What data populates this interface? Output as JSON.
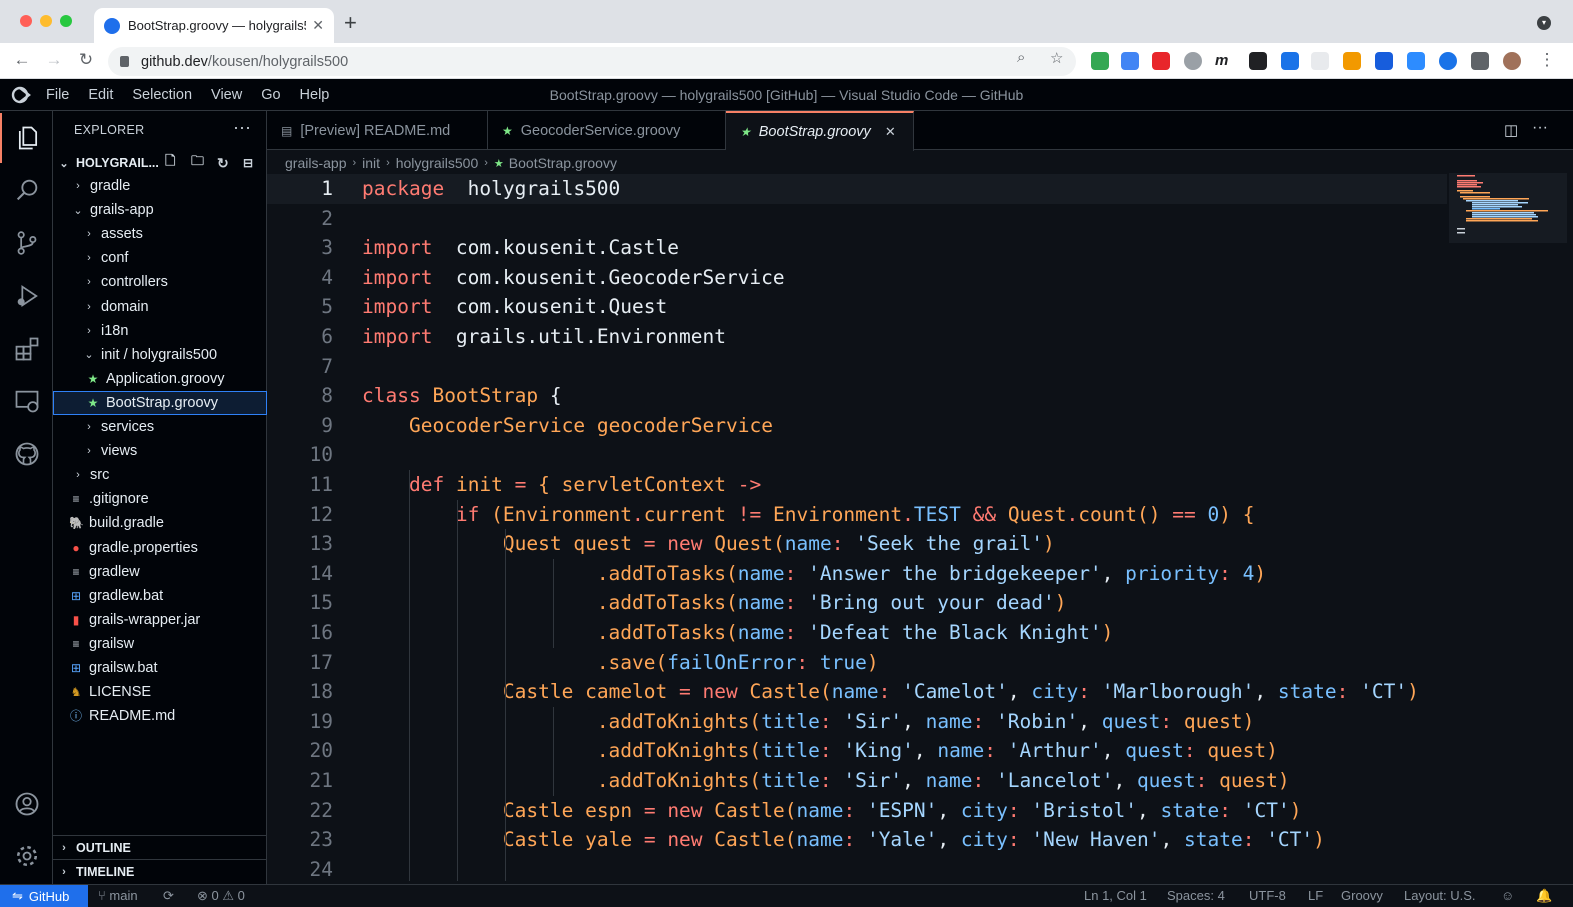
{
  "browser": {
    "tab_title": "BootStrap.groovy — holygrails5",
    "tab_close": "✕",
    "new_tab": "+",
    "url_domain": "github.dev",
    "url_path": "/kousen/holygrails500"
  },
  "vscode": {
    "menu": [
      "File",
      "Edit",
      "Selection",
      "View",
      "Go",
      "Help"
    ],
    "window_title": "BootStrap.groovy — holygrails500 [GitHub] — Visual Studio Code — GitHub",
    "explorer_title": "EXPLORER",
    "explorer_more": "···",
    "folder_name": "HOLYGRAIL...",
    "tree": [
      {
        "label": "gradle",
        "kind": "folder",
        "depth": 1,
        "open": false
      },
      {
        "label": "grails-app",
        "kind": "folder",
        "depth": 1,
        "open": true
      },
      {
        "label": "assets",
        "kind": "folder",
        "depth": 2,
        "open": false
      },
      {
        "label": "conf",
        "kind": "folder",
        "depth": 2,
        "open": false
      },
      {
        "label": "controllers",
        "kind": "folder",
        "depth": 2,
        "open": false
      },
      {
        "label": "domain",
        "kind": "folder",
        "depth": 2,
        "open": false
      },
      {
        "label": "i18n",
        "kind": "folder",
        "depth": 2,
        "open": false
      },
      {
        "label": "init / holygrails500",
        "kind": "folder",
        "depth": 2,
        "open": true
      },
      {
        "label": "Application.groovy",
        "kind": "groovy",
        "depth": 3
      },
      {
        "label": "BootStrap.groovy",
        "kind": "groovy",
        "depth": 3,
        "selected": true
      },
      {
        "label": "services",
        "kind": "folder",
        "depth": 2,
        "open": false
      },
      {
        "label": "views",
        "kind": "folder",
        "depth": 2,
        "open": false
      },
      {
        "label": "src",
        "kind": "folder",
        "depth": 1,
        "open": false
      },
      {
        "label": ".gitignore",
        "kind": "text",
        "depth": 1
      },
      {
        "label": "build.gradle",
        "kind": "gradle",
        "depth": 1
      },
      {
        "label": "gradle.properties",
        "kind": "props",
        "depth": 1
      },
      {
        "label": "gradlew",
        "kind": "text",
        "depth": 1
      },
      {
        "label": "gradlew.bat",
        "kind": "win",
        "depth": 1
      },
      {
        "label": "grails-wrapper.jar",
        "kind": "jar",
        "depth": 1
      },
      {
        "label": "grailsw",
        "kind": "text",
        "depth": 1
      },
      {
        "label": "grailsw.bat",
        "kind": "win",
        "depth": 1
      },
      {
        "label": "LICENSE",
        "kind": "license",
        "depth": 1
      },
      {
        "label": "README.md",
        "kind": "info",
        "depth": 1
      }
    ],
    "outline_label": "OUTLINE",
    "timeline_label": "TIMELINE",
    "editor_tabs": [
      {
        "label": "[Preview] README.md",
        "active": false
      },
      {
        "label": "GeocoderService.groovy",
        "active": false
      },
      {
        "label": "BootStrap.groovy",
        "active": true
      }
    ],
    "tab_close": "✕",
    "breadcrumb": [
      "grails-app",
      "init",
      "holygrails500",
      "BootStrap.groovy"
    ],
    "code_lines": [
      [
        [
          "kw",
          "package"
        ],
        [
          "",
          "  holygrails500"
        ]
      ],
      [],
      [
        [
          "kw",
          "import"
        ],
        [
          "",
          "  com.kousenit.Castle"
        ]
      ],
      [
        [
          "kw",
          "import"
        ],
        [
          "",
          "  com.kousenit.GeocoderService"
        ]
      ],
      [
        [
          "kw",
          "import"
        ],
        [
          "",
          "  com.kousenit.Quest"
        ]
      ],
      [
        [
          "kw",
          "import"
        ],
        [
          "",
          "  grails.util.Environment"
        ]
      ],
      [],
      [
        [
          "kw",
          "class"
        ],
        [
          "",
          " "
        ],
        [
          "ty",
          "BootStrap"
        ],
        [
          "",
          " {"
        ]
      ],
      [
        [
          "",
          "    "
        ],
        [
          "ty",
          "GeocoderService"
        ],
        [
          "",
          " "
        ],
        [
          "ty",
          "geocoderService"
        ]
      ],
      [],
      [
        [
          "",
          "    "
        ],
        [
          "kw",
          "def"
        ],
        [
          "",
          " "
        ],
        [
          "ty",
          "init"
        ],
        [
          "",
          " "
        ],
        [
          "kw",
          "="
        ],
        [
          "",
          " "
        ],
        [
          "ty",
          "{"
        ],
        [
          "",
          " "
        ],
        [
          "ty",
          "servletContext"
        ],
        [
          "",
          " "
        ],
        [
          "kw",
          "->"
        ]
      ],
      [
        [
          "",
          "        "
        ],
        [
          "kw",
          "if"
        ],
        [
          "",
          " "
        ],
        [
          "ty",
          "(Environment"
        ],
        [
          "kw",
          "."
        ],
        [
          "ty",
          "current"
        ],
        [
          "",
          " "
        ],
        [
          "kw",
          "!="
        ],
        [
          "",
          " "
        ],
        [
          "ty",
          "Environment"
        ],
        [
          "kw",
          "."
        ],
        [
          "pr",
          "TEST"
        ],
        [
          "",
          " "
        ],
        [
          "kw",
          "&&"
        ],
        [
          "",
          " "
        ],
        [
          "ty",
          "Quest"
        ],
        [
          "kw",
          "."
        ],
        [
          "ty",
          "count"
        ],
        [
          "ty",
          "()"
        ],
        [
          "",
          " "
        ],
        [
          "kw",
          "=="
        ],
        [
          "",
          " "
        ],
        [
          "nu",
          "0"
        ],
        [
          "ty",
          ")"
        ],
        [
          "",
          " "
        ],
        [
          "ty",
          "{"
        ]
      ],
      [
        [
          "",
          "            "
        ],
        [
          "ty",
          "Quest"
        ],
        [
          "",
          " "
        ],
        [
          "ty",
          "quest"
        ],
        [
          "",
          " "
        ],
        [
          "kw",
          "="
        ],
        [
          "",
          " "
        ],
        [
          "kw",
          "new"
        ],
        [
          "",
          " "
        ],
        [
          "ty",
          "Quest("
        ],
        [
          "pr",
          "name"
        ],
        [
          "kw",
          ":"
        ],
        [
          "",
          " "
        ],
        [
          "st",
          "'Seek the grail'"
        ],
        [
          "ty",
          ")"
        ]
      ],
      [
        [
          "",
          "                    "
        ],
        [
          "ty",
          ".addToTasks("
        ],
        [
          "pr",
          "name"
        ],
        [
          "kw",
          ":"
        ],
        [
          "",
          " "
        ],
        [
          "st",
          "'Answer the bridgekeeper'"
        ],
        [
          "",
          ", "
        ],
        [
          "pr",
          "priority"
        ],
        [
          "kw",
          ":"
        ],
        [
          "",
          " "
        ],
        [
          "nu",
          "4"
        ],
        [
          "ty",
          ")"
        ]
      ],
      [
        [
          "",
          "                    "
        ],
        [
          "ty",
          ".addToTasks("
        ],
        [
          "pr",
          "name"
        ],
        [
          "kw",
          ":"
        ],
        [
          "",
          " "
        ],
        [
          "st",
          "'Bring out your dead'"
        ],
        [
          "ty",
          ")"
        ]
      ],
      [
        [
          "",
          "                    "
        ],
        [
          "ty",
          ".addToTasks("
        ],
        [
          "pr",
          "name"
        ],
        [
          "kw",
          ":"
        ],
        [
          "",
          " "
        ],
        [
          "st",
          "'Defeat the Black Knight'"
        ],
        [
          "ty",
          ")"
        ]
      ],
      [
        [
          "",
          "                    "
        ],
        [
          "ty",
          ".save("
        ],
        [
          "pr",
          "failOnError"
        ],
        [
          "kw",
          ":"
        ],
        [
          "",
          " "
        ],
        [
          "pr",
          "true"
        ],
        [
          "ty",
          ")"
        ]
      ],
      [
        [
          "",
          "            "
        ],
        [
          "ty",
          "Castle"
        ],
        [
          "",
          " "
        ],
        [
          "ty",
          "camelot"
        ],
        [
          "",
          " "
        ],
        [
          "kw",
          "="
        ],
        [
          "",
          " "
        ],
        [
          "kw",
          "new"
        ],
        [
          "",
          " "
        ],
        [
          "ty",
          "Castle("
        ],
        [
          "pr",
          "name"
        ],
        [
          "kw",
          ":"
        ],
        [
          "",
          " "
        ],
        [
          "st",
          "'Camelot'"
        ],
        [
          "",
          ", "
        ],
        [
          "pr",
          "city"
        ],
        [
          "kw",
          ":"
        ],
        [
          "",
          " "
        ],
        [
          "st",
          "'Marlborough'"
        ],
        [
          "",
          ", "
        ],
        [
          "pr",
          "state"
        ],
        [
          "kw",
          ":"
        ],
        [
          "",
          " "
        ],
        [
          "st",
          "'CT'"
        ],
        [
          "ty",
          ")"
        ]
      ],
      [
        [
          "",
          "                    "
        ],
        [
          "ty",
          ".addToKnights("
        ],
        [
          "pr",
          "title"
        ],
        [
          "kw",
          ":"
        ],
        [
          "",
          " "
        ],
        [
          "st",
          "'Sir'"
        ],
        [
          "",
          ", "
        ],
        [
          "pr",
          "name"
        ],
        [
          "kw",
          ":"
        ],
        [
          "",
          " "
        ],
        [
          "st",
          "'Robin'"
        ],
        [
          "",
          ", "
        ],
        [
          "pr",
          "quest"
        ],
        [
          "kw",
          ":"
        ],
        [
          "",
          " "
        ],
        [
          "ty",
          "quest)"
        ]
      ],
      [
        [
          "",
          "                    "
        ],
        [
          "ty",
          ".addToKnights("
        ],
        [
          "pr",
          "title"
        ],
        [
          "kw",
          ":"
        ],
        [
          "",
          " "
        ],
        [
          "st",
          "'King'"
        ],
        [
          "",
          ", "
        ],
        [
          "pr",
          "name"
        ],
        [
          "kw",
          ":"
        ],
        [
          "",
          " "
        ],
        [
          "st",
          "'Arthur'"
        ],
        [
          "",
          ", "
        ],
        [
          "pr",
          "quest"
        ],
        [
          "kw",
          ":"
        ],
        [
          "",
          " "
        ],
        [
          "ty",
          "quest)"
        ]
      ],
      [
        [
          "",
          "                    "
        ],
        [
          "ty",
          ".addToKnights("
        ],
        [
          "pr",
          "title"
        ],
        [
          "kw",
          ":"
        ],
        [
          "",
          " "
        ],
        [
          "st",
          "'Sir'"
        ],
        [
          "",
          ", "
        ],
        [
          "pr",
          "name"
        ],
        [
          "kw",
          ":"
        ],
        [
          "",
          " "
        ],
        [
          "st",
          "'Lancelot'"
        ],
        [
          "",
          ", "
        ],
        [
          "pr",
          "quest"
        ],
        [
          "kw",
          ":"
        ],
        [
          "",
          " "
        ],
        [
          "ty",
          "quest)"
        ]
      ],
      [
        [
          "",
          "            "
        ],
        [
          "ty",
          "Castle"
        ],
        [
          "",
          " "
        ],
        [
          "ty",
          "espn"
        ],
        [
          "",
          " "
        ],
        [
          "kw",
          "="
        ],
        [
          "",
          " "
        ],
        [
          "kw",
          "new"
        ],
        [
          "",
          " "
        ],
        [
          "ty",
          "Castle("
        ],
        [
          "pr",
          "name"
        ],
        [
          "kw",
          ":"
        ],
        [
          "",
          " "
        ],
        [
          "st",
          "'ESPN'"
        ],
        [
          "",
          ", "
        ],
        [
          "pr",
          "city"
        ],
        [
          "kw",
          ":"
        ],
        [
          "",
          " "
        ],
        [
          "st",
          "'Bristol'"
        ],
        [
          "",
          ", "
        ],
        [
          "pr",
          "state"
        ],
        [
          "kw",
          ":"
        ],
        [
          "",
          " "
        ],
        [
          "st",
          "'CT'"
        ],
        [
          "ty",
          ")"
        ]
      ],
      [
        [
          "",
          "            "
        ],
        [
          "ty",
          "Castle"
        ],
        [
          "",
          " "
        ],
        [
          "ty",
          "yale"
        ],
        [
          "",
          " "
        ],
        [
          "kw",
          "="
        ],
        [
          "",
          " "
        ],
        [
          "kw",
          "new"
        ],
        [
          "",
          " "
        ],
        [
          "ty",
          "Castle("
        ],
        [
          "pr",
          "name"
        ],
        [
          "kw",
          ":"
        ],
        [
          "",
          " "
        ],
        [
          "st",
          "'Yale'"
        ],
        [
          "",
          ", "
        ],
        [
          "pr",
          "city"
        ],
        [
          "kw",
          ":"
        ],
        [
          "",
          " "
        ],
        [
          "st",
          "'New Haven'"
        ],
        [
          "",
          ", "
        ],
        [
          "pr",
          "state"
        ],
        [
          "kw",
          ":"
        ],
        [
          "",
          " "
        ],
        [
          "st",
          "'CT'"
        ],
        [
          "ty",
          ")"
        ]
      ],
      []
    ],
    "status": {
      "remote": "GitHub",
      "branch": "main",
      "errors": "0",
      "warnings": "0",
      "position": "Ln 1, Col 1",
      "spaces": "Spaces: 4",
      "encoding": "UTF-8",
      "eol": "LF",
      "language": "Groovy",
      "layout": "Layout: U.S."
    }
  },
  "colors": {
    "keyword": "#ff7b72",
    "type": "#ffa657",
    "string": "#a5d6ff",
    "property": "#79c0ff",
    "accent": "#1f6feb",
    "background": "#0d1117"
  }
}
